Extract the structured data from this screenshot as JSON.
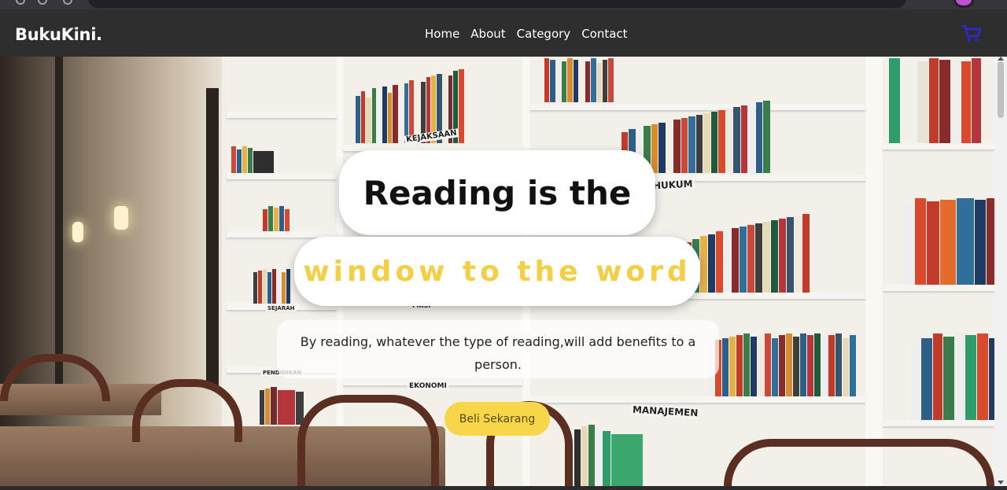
{
  "brand": "BukuKini.",
  "nav": {
    "items": [
      "Home",
      "About",
      "Category",
      "Contact"
    ]
  },
  "icons": {
    "cart": "shopping-cart-icon"
  },
  "hero": {
    "headline_line1": "Reading is the",
    "headline_line2": "window to the word",
    "subtitle": "By reading, whatever the type of reading,will add benefits to a person.",
    "cta_label": "Beli Sekarang",
    "shelf_labels": [
      "KEJAKSAAN",
      "HUKUM",
      "SEJARAH",
      "FIKSI",
      "PENDIDIKAN",
      "EKONOMI",
      "MANAJEMEN"
    ]
  },
  "colors": {
    "navbar_bg": "#2e2e2e",
    "accent_yellow": "#f2cf45",
    "cta_bg": "#f7d649",
    "cart_icon": "#2b2bd6"
  }
}
